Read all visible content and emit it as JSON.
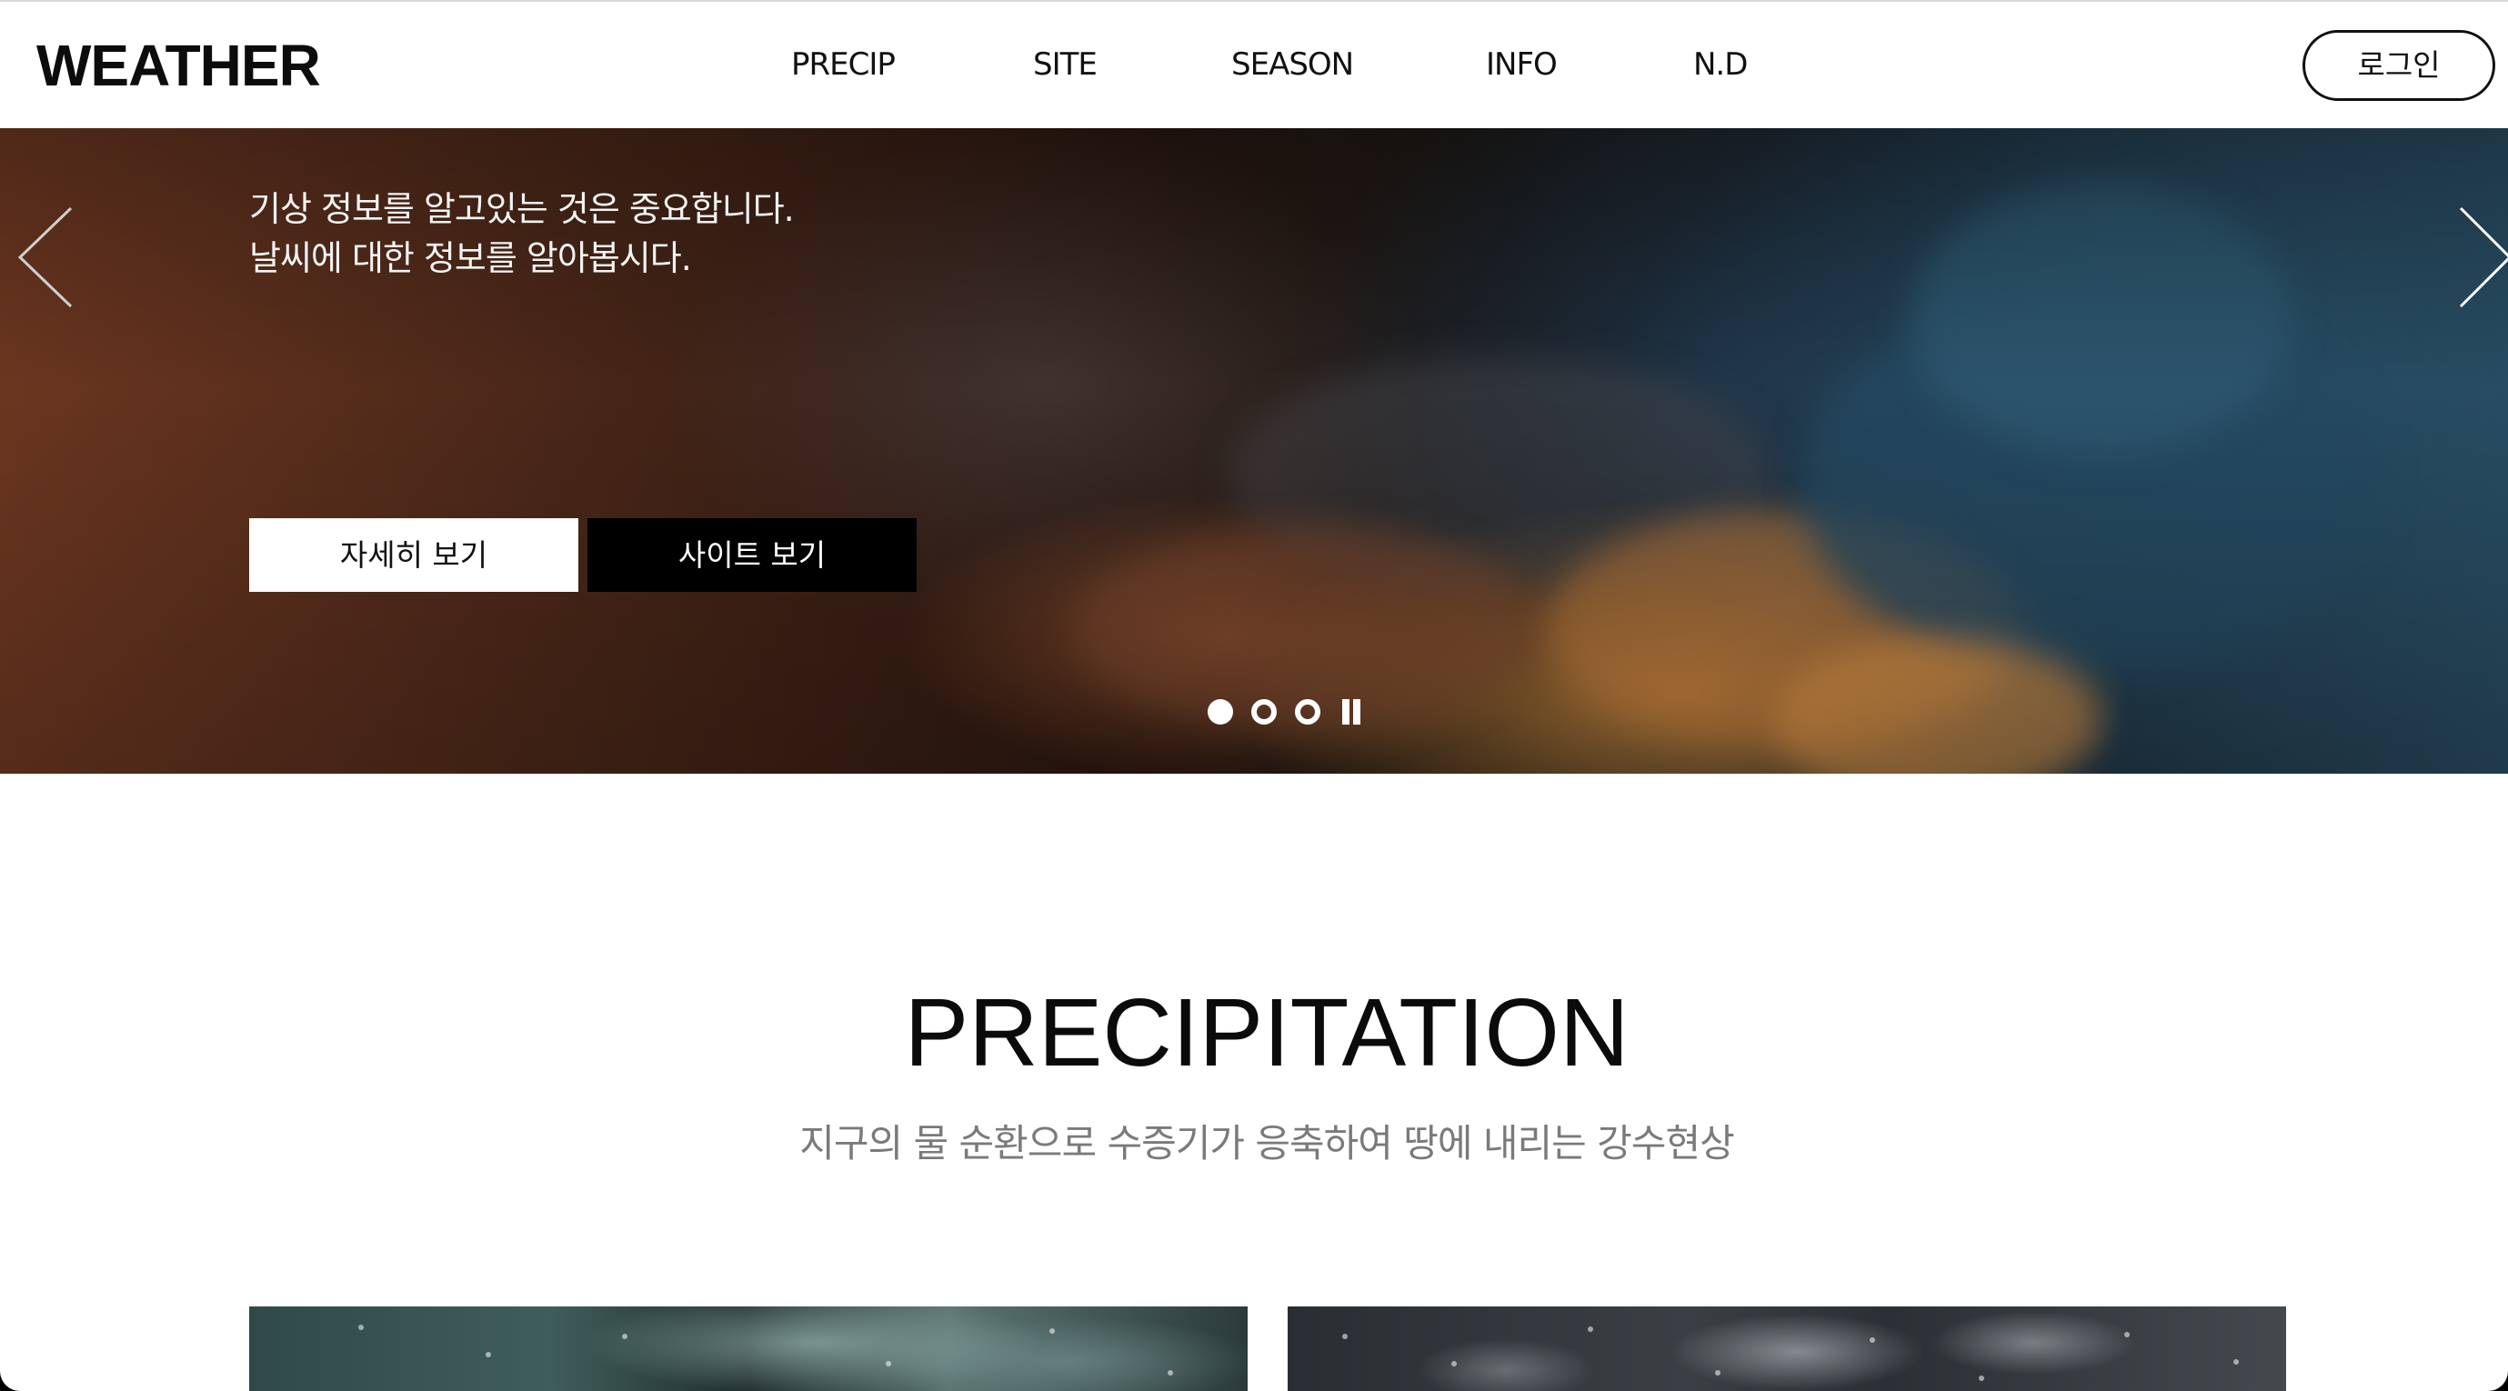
{
  "header": {
    "logo": "WEATHER",
    "nav": [
      "PRECIP",
      "SITE",
      "SEASON",
      "INFO",
      "N.D"
    ],
    "login_label": "로그인"
  },
  "hero": {
    "line1": "기상 정보를 알고있는 것은 중요합니다.",
    "line2": "날씨에 대한 정보를 알아봅시다.",
    "detail_button": "자세히 보기",
    "site_button": "사이트 보기",
    "slides_total": 3,
    "slide_active": 1,
    "icons": {
      "prev": "chevron-left-icon",
      "next": "chevron-right-icon",
      "pause": "pause-icon"
    }
  },
  "section": {
    "title": "PRECIPITATION",
    "subtitle": "지구의 물 순환으로 수증기가 응축하여 땅에 내리는 강수현상"
  }
}
